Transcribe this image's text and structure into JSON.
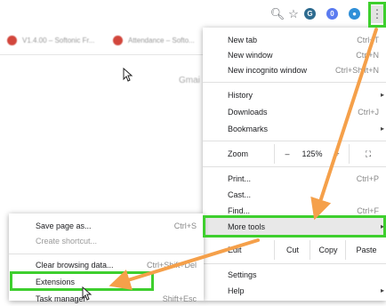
{
  "toolbar": {
    "icons": [
      "zoom-icon",
      "star-icon",
      "extension-icon-1",
      "extension-icon-2",
      "extension-icon-3",
      "more-vertical-icon"
    ]
  },
  "bookmarks": [
    {
      "label": "V1.4.00 – Softonic Fr..."
    },
    {
      "label": "Attendance – Softo..."
    }
  ],
  "page": {
    "partial_text": "Gmai"
  },
  "main_menu": {
    "new_tab": {
      "label": "New tab",
      "shortcut": "Ctrl+T"
    },
    "new_window": {
      "label": "New window",
      "shortcut": "Ctrl+N"
    },
    "new_incognito": {
      "label": "New incognito window",
      "shortcut": "Ctrl+Shift+N"
    },
    "history": {
      "label": "History"
    },
    "downloads": {
      "label": "Downloads",
      "shortcut": "Ctrl+J"
    },
    "bookmarks": {
      "label": "Bookmarks"
    },
    "zoom": {
      "label": "Zoom",
      "minus": "–",
      "level": "125%",
      "plus": "+",
      "fullscreen": "⛶"
    },
    "print": {
      "label": "Print...",
      "shortcut": "Ctrl+P"
    },
    "cast": {
      "label": "Cast..."
    },
    "find": {
      "label": "Find...",
      "shortcut": "Ctrl+F"
    },
    "more_tools": {
      "label": "More tools"
    },
    "edit": {
      "label": "Edit",
      "cut": "Cut",
      "copy": "Copy",
      "paste": "Paste"
    },
    "settings": {
      "label": "Settings"
    },
    "help": {
      "label": "Help"
    }
  },
  "submenu": {
    "save_page": {
      "label": "Save page as...",
      "shortcut": "Ctrl+S"
    },
    "create_shortcut": {
      "label": "Create shortcut..."
    },
    "clear_browsing": {
      "label": "Clear browsing data...",
      "shortcut": "Ctrl+Shift+Del"
    },
    "extensions": {
      "label": "Extensions"
    },
    "task_manager": {
      "label": "Task manager",
      "shortcut": "Shift+Esc"
    }
  },
  "colors": {
    "highlight": "#3ecf2e",
    "arrow": "#f5a04a"
  }
}
